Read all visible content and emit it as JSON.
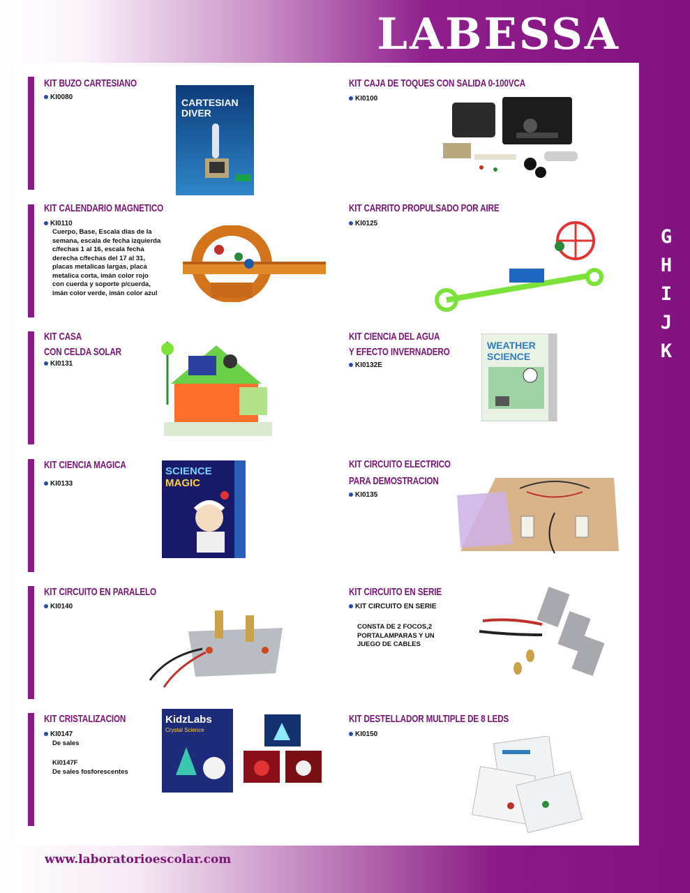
{
  "brand": "LABESSA",
  "side_letters": [
    "G",
    "H",
    "I",
    "J",
    "K"
  ],
  "footer": {
    "website": "www.laboratorioescolar.com"
  },
  "products": {
    "buzo": {
      "title": "KIT BUZO CARTESIANO",
      "code": "KI0080",
      "box_line1": "CARTESIAN",
      "box_line2": "DIVER"
    },
    "caja": {
      "title": "KIT CAJA DE TOQUES CON SALIDA 0-100VCA",
      "code": "KI0100"
    },
    "calendario": {
      "title": "KIT CALENDARIO MAGNETICO",
      "code": "KI0110",
      "desc": [
        "Cuerpo, Base, Escala dias de la",
        "semana, escala de fecha izquierda",
        "c/fechas 1 al 16, escala fecha",
        "derecha c/fechas del 17 al 31,",
        "placas metalicas largas, placa",
        "metalica corta, imán color rojo",
        "con cuerda y soporte p/cuerda,",
        "imán color verde, imán color azul"
      ]
    },
    "carrito": {
      "title": "KIT CARRITO PROPULSADO POR AIRE",
      "code": "KI0125"
    },
    "casa": {
      "title_line1": "KIT CASA",
      "title_line2": "CON CELDA SOLAR",
      "code": "KI0131"
    },
    "agua": {
      "title_line1": "KIT CIENCIA DEL AGUA",
      "title_line2": "Y EFECTO INVERNADERO",
      "code": "KI0132E",
      "box_line1": "WEATHER",
      "box_line2": "SCIENCE"
    },
    "magica": {
      "title": "KIT CIENCIA MAGICA",
      "code": "KI0133",
      "box_line1": "SCIENCE",
      "box_line2": "MAGIC"
    },
    "demostracion": {
      "title_line1": "KIT CIRCUITO ELECTRICO",
      "title_line2": "PARA DEMOSTRACION",
      "code": "KI0135"
    },
    "paralelo": {
      "title": "KIT CIRCUITO EN PARALELO",
      "code": "KI0140"
    },
    "serie": {
      "title": "KIT CIRCUITO EN SERIE",
      "code": "KIT CIRCUITO EN SERIE",
      "desc": [
        "CONSTA DE 2 FOCOS,2",
        "PORTALAMPARAS Y UN",
        "JUEGO DE CABLES"
      ]
    },
    "cristalizacion": {
      "title": "KIT CRISTALIZACION",
      "code": "KI0147",
      "sub1": "De sales",
      "code2": "KI0147F",
      "sub2": "De sales fosforescentes",
      "box_line1": "KidzLabs",
      "box_line2": "Crystal Science"
    },
    "destellador": {
      "title": "KIT DESTELLADOR MULTIPLE DE 8 LEDS",
      "code": "KI0150"
    }
  },
  "colors": {
    "purple": "#82127f",
    "title": "#7a1477",
    "bullet": "#2b4aa8"
  }
}
